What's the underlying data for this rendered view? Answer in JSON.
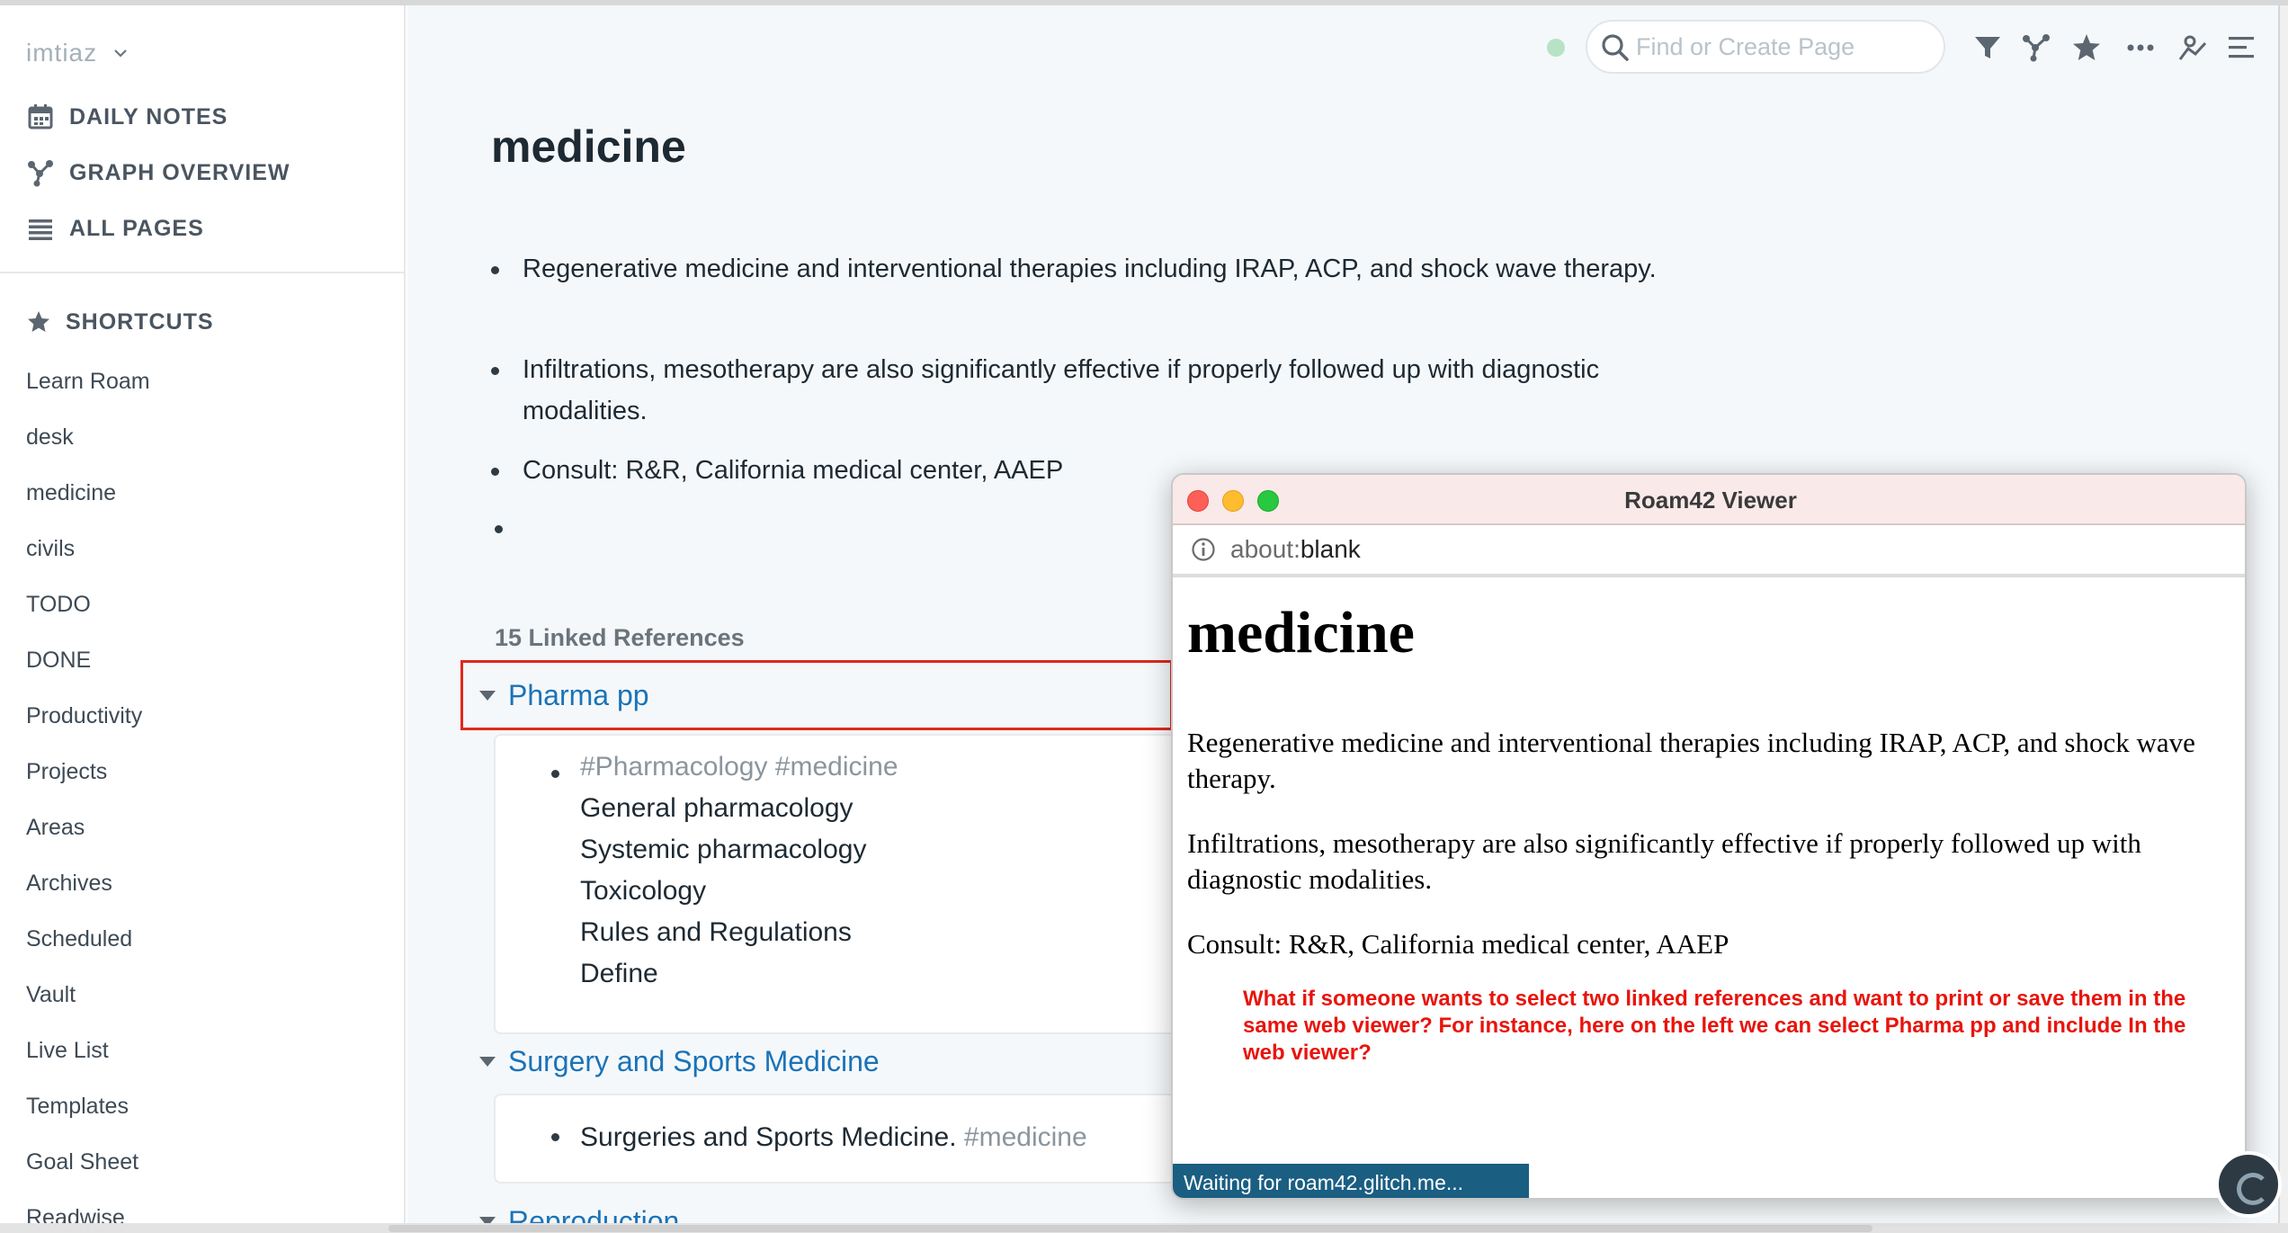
{
  "sidebar": {
    "user": "imtiaz",
    "nav": [
      {
        "label": "DAILY NOTES",
        "icon": "calendar-icon"
      },
      {
        "label": "GRAPH OVERVIEW",
        "icon": "graph-icon"
      },
      {
        "label": "ALL PAGES",
        "icon": "list-icon"
      }
    ],
    "shortcuts_title": "SHORTCUTS",
    "shortcuts": [
      "Learn Roam",
      "desk",
      "medicine",
      "civils",
      "TODO",
      "DONE",
      "Productivity",
      "Projects",
      "Areas",
      "Archives",
      "Scheduled",
      "Vault",
      "Live List",
      "Templates",
      "Goal Sheet",
      "Readwise"
    ]
  },
  "topbar": {
    "search_placeholder": "Find or Create Page",
    "icons": [
      "filter-icon",
      "graph-icon",
      "star-icon",
      "more-icon",
      "sidebar-open-icon",
      "menu-icon"
    ]
  },
  "page": {
    "title": "medicine",
    "blocks": [
      "Regenerative medicine and interventional therapies including IRAP, ACP, and shock wave therapy.",
      "Infiltrations, mesotherapy are also significantly effective if properly followed up with diagnostic modalities.",
      "Consult: R&R, California medical center, AAEP"
    ],
    "linked_refs_title": "15 Linked References",
    "refs": [
      {
        "title": "Pharma pp",
        "tags": "#Pharmacology #medicine",
        "lines": [
          "General pharmacology",
          "Systemic pharmacology",
          "Toxicology",
          "Rules and Regulations",
          "Define"
        ]
      },
      {
        "title": "Surgery and Sports Medicine",
        "text": "Surgeries and Sports Medicine.",
        "tag": "#medicine"
      },
      {
        "title": "Reproduction"
      }
    ]
  },
  "viewer": {
    "title": "Roam42 Viewer",
    "url_scheme": "about:",
    "url_path": "blank",
    "heading": "medicine",
    "paragraphs": [
      "Regenerative medicine and interventional therapies including IRAP, ACP, and shock wave therapy.",
      "Infiltrations, mesotherapy are also significantly effective if properly followed up with diagnostic modalities.",
      "Consult: R&R, California medical center, AAEP"
    ],
    "annotation": "What if someone wants to select two linked references and want to print or save them in the same web viewer? For instance,  here on the left we can select Pharma pp and include In the web viewer?",
    "status": "Waiting for roam42.glitch.me...",
    "colors": {
      "close": "#fe5f57",
      "minimize": "#febc2e",
      "maximize": "#28c840"
    }
  },
  "colors": {
    "link": "#1a73b8",
    "highlight": "#e0281e",
    "annotation": "#e8140c",
    "status_bar": "#1a5e82"
  }
}
